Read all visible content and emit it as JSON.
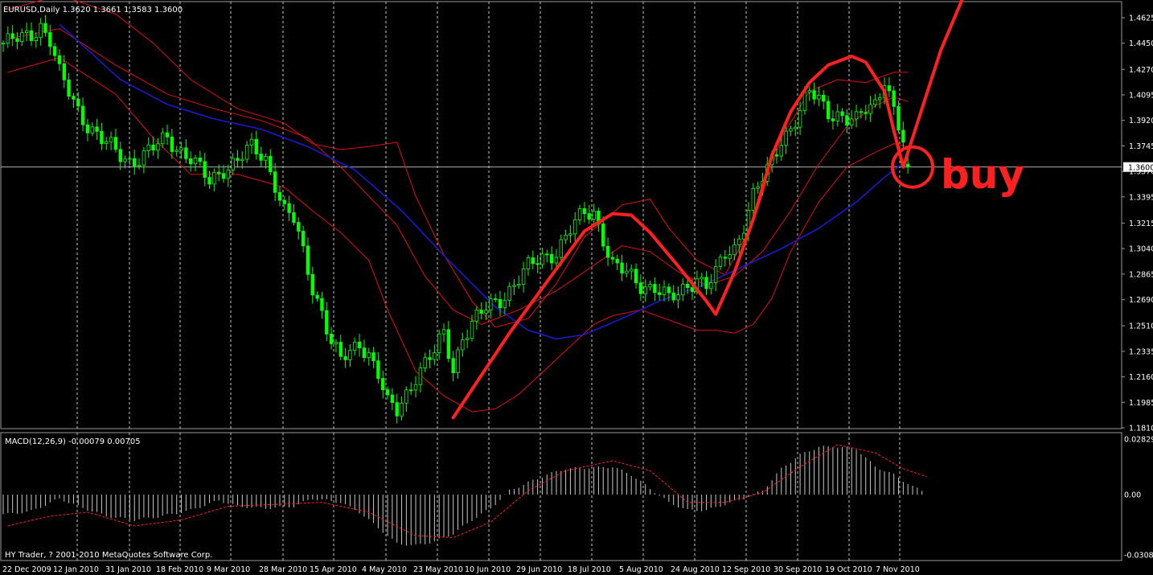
{
  "main_label": "EURUSD,Daily  1.3620 1.3661 1.3583 1.3600",
  "macd_label": "MACD(12,26,9) -0.00079 0.00705",
  "copyright": "HY Trader, ? 2001-2010 MetaQuotes Software Corp.",
  "buy_label": "buy",
  "colors": {
    "background": "#000000",
    "candle": "#00ff00",
    "ma": "#1a1ad0",
    "bands": "#e01010",
    "annotation": "#ff2020",
    "grid": "#c8c8c8",
    "axis_text": "#ffffff",
    "macd_hist": "#c8c8c8",
    "macd_signal": "#ff2020"
  },
  "chart_data": [
    {
      "type": "candlestick",
      "title": "EURUSD,Daily",
      "ohlc_last": {
        "open": 1.362,
        "high": 1.3661,
        "low": 1.3583,
        "close": 1.36
      },
      "ylim": [
        1.181,
        1.471
      ],
      "y_ticks": [
        "1.4625",
        "1.4450",
        "1.4270",
        "1.4095",
        "1.3920",
        "1.3745",
        "1.3570",
        "1.3395",
        "1.3215",
        "1.3040",
        "1.2865",
        "1.2690",
        "1.2510",
        "1.2335",
        "1.2160",
        "1.1985",
        "1.1810"
      ],
      "current_price_label": "1.3600",
      "x_ticks": [
        "22 Dec 2009",
        "12 Jan 2010",
        "31 Jan 2010",
        "18 Feb 2010",
        "9 Mar 2010",
        "28 Mar 2010",
        "15 Apr 2010",
        "4 May 2010",
        "23 May 2010",
        "10 Jun 2010",
        "29 Jun 2010",
        "18 Jul 2010",
        "5 Aug 2010",
        "24 Aug 2010",
        "12 Sep 2010",
        "30 Sep 2010",
        "19 Oct 2010",
        "7 Nov 2010"
      ],
      "close_path": [
        [
          1,
          1.445
        ],
        [
          4,
          1.448
        ],
        [
          6,
          1.452
        ],
        [
          8,
          1.458
        ],
        [
          10,
          1.447
        ],
        [
          12,
          1.423
        ],
        [
          15,
          1.405
        ],
        [
          18,
          1.39
        ],
        [
          21,
          1.378
        ],
        [
          24,
          1.37
        ],
        [
          27,
          1.365
        ],
        [
          30,
          1.368
        ],
        [
          32,
          1.372
        ],
        [
          35,
          1.38
        ],
        [
          38,
          1.372
        ],
        [
          40,
          1.366
        ],
        [
          42,
          1.357
        ],
        [
          44,
          1.349
        ],
        [
          47,
          1.36
        ],
        [
          50,
          1.365
        ],
        [
          53,
          1.372
        ],
        [
          56,
          1.366
        ],
        [
          58,
          1.35
        ],
        [
          60,
          1.33
        ],
        [
          62,
          1.323
        ],
        [
          64,
          1.3
        ],
        [
          66,
          1.278
        ],
        [
          68,
          1.262
        ],
        [
          70,
          1.24
        ],
        [
          72,
          1.226
        ],
        [
          74,
          1.232
        ],
        [
          76,
          1.24
        ],
        [
          78,
          1.233
        ],
        [
          80,
          1.218
        ],
        [
          82,
          1.196
        ],
        [
          84,
          1.192
        ],
        [
          86,
          1.205
        ],
        [
          88,
          1.218
        ],
        [
          90,
          1.225
        ],
        [
          92,
          1.232
        ],
        [
          94,
          1.245
        ],
        [
          96,
          1.222
        ],
        [
          98,
          1.245
        ],
        [
          100,
          1.252
        ],
        [
          103,
          1.262
        ],
        [
          106,
          1.27
        ],
        [
          109,
          1.28
        ],
        [
          112,
          1.29
        ],
        [
          115,
          1.298
        ],
        [
          118,
          1.303
        ],
        [
          121,
          1.316
        ],
        [
          124,
          1.328
        ],
        [
          126,
          1.33
        ],
        [
          128,
          1.312
        ],
        [
          130,
          1.292
        ],
        [
          133,
          1.286
        ],
        [
          136,
          1.28
        ],
        [
          139,
          1.278
        ],
        [
          142,
          1.268
        ],
        [
          144,
          1.272
        ],
        [
          146,
          1.28
        ],
        [
          148,
          1.285
        ],
        [
          150,
          1.278
        ],
        [
          152,
          1.285
        ],
        [
          154,
          1.3
        ],
        [
          156,
          1.305
        ],
        [
          158,
          1.322
        ],
        [
          160,
          1.34
        ],
        [
          163,
          1.356
        ],
        [
          166,
          1.38
        ],
        [
          168,
          1.388
        ],
        [
          170,
          1.398
        ],
        [
          172,
          1.41
        ],
        [
          174,
          1.406
        ],
        [
          176,
          1.399
        ],
        [
          178,
          1.397
        ],
        [
          180,
          1.392
        ],
        [
          182,
          1.39
        ],
        [
          184,
          1.4
        ],
        [
          186,
          1.405
        ],
        [
          188,
          1.422
        ],
        [
          190,
          1.398
        ],
        [
          192,
          1.375
        ],
        [
          193,
          1.36
        ]
      ],
      "ma_path": [
        [
          12,
          1.458
        ],
        [
          25,
          1.42
        ],
        [
          35,
          1.403
        ],
        [
          45,
          1.393
        ],
        [
          55,
          1.386
        ],
        [
          65,
          1.374
        ],
        [
          75,
          1.358
        ],
        [
          85,
          1.33
        ],
        [
          95,
          1.296
        ],
        [
          105,
          1.264
        ],
        [
          112,
          1.248
        ],
        [
          118,
          1.242
        ],
        [
          124,
          1.245
        ],
        [
          132,
          1.256
        ],
        [
          140,
          1.268
        ],
        [
          150,
          1.28
        ],
        [
          158,
          1.292
        ],
        [
          166,
          1.304
        ],
        [
          174,
          1.318
        ],
        [
          182,
          1.336
        ],
        [
          188,
          1.353
        ],
        [
          193,
          1.365
        ]
      ],
      "band_upper_path": [
        [
          1,
          1.468
        ],
        [
          12,
          1.478
        ],
        [
          24,
          1.465
        ],
        [
          32,
          1.445
        ],
        [
          40,
          1.42
        ],
        [
          50,
          1.4
        ],
        [
          60,
          1.39
        ],
        [
          66,
          1.376
        ],
        [
          72,
          1.372
        ],
        [
          78,
          1.374
        ],
        [
          84,
          1.377
        ],
        [
          88,
          1.34
        ],
        [
          94,
          1.3
        ],
        [
          100,
          1.268
        ],
        [
          105,
          1.25
        ],
        [
          112,
          1.256
        ],
        [
          118,
          1.28
        ],
        [
          124,
          1.312
        ],
        [
          132,
          1.334
        ],
        [
          138,
          1.338
        ],
        [
          142,
          1.318
        ],
        [
          148,
          1.296
        ],
        [
          154,
          1.286
        ],
        [
          160,
          1.322
        ],
        [
          166,
          1.38
        ],
        [
          172,
          1.412
        ],
        [
          178,
          1.42
        ],
        [
          184,
          1.418
        ],
        [
          190,
          1.425
        ],
        [
          193,
          1.425
        ]
      ],
      "band_middle_path": [
        [
          1,
          1.448
        ],
        [
          12,
          1.455
        ],
        [
          24,
          1.43
        ],
        [
          35,
          1.41
        ],
        [
          45,
          1.4
        ],
        [
          55,
          1.392
        ],
        [
          65,
          1.38
        ],
        [
          72,
          1.36
        ],
        [
          78,
          1.34
        ],
        [
          84,
          1.32
        ],
        [
          90,
          1.285
        ],
        [
          96,
          1.262
        ],
        [
          102,
          1.252
        ],
        [
          110,
          1.262
        ],
        [
          118,
          1.275
        ],
        [
          124,
          1.288
        ],
        [
          132,
          1.306
        ],
        [
          138,
          1.302
        ],
        [
          144,
          1.288
        ],
        [
          150,
          1.279
        ],
        [
          156,
          1.285
        ],
        [
          162,
          1.302
        ],
        [
          168,
          1.33
        ],
        [
          174,
          1.362
        ],
        [
          180,
          1.388
        ],
        [
          186,
          1.402
        ],
        [
          190,
          1.408
        ],
        [
          193,
          1.405
        ]
      ],
      "band_lower_path": [
        [
          1,
          1.425
        ],
        [
          12,
          1.435
        ],
        [
          24,
          1.41
        ],
        [
          32,
          1.38
        ],
        [
          40,
          1.355
        ],
        [
          50,
          1.355
        ],
        [
          60,
          1.346
        ],
        [
          66,
          1.33
        ],
        [
          72,
          1.315
        ],
        [
          78,
          1.296
        ],
        [
          82,
          1.262
        ],
        [
          88,
          1.22
        ],
        [
          94,
          1.203
        ],
        [
          100,
          1.192
        ],
        [
          105,
          1.194
        ],
        [
          110,
          1.204
        ],
        [
          116,
          1.222
        ],
        [
          122,
          1.24
        ],
        [
          126,
          1.252
        ],
        [
          130,
          1.258
        ],
        [
          136,
          1.262
        ],
        [
          142,
          1.255
        ],
        [
          148,
          1.248
        ],
        [
          152,
          1.248
        ],
        [
          156,
          1.246
        ],
        [
          160,
          1.252
        ],
        [
          164,
          1.27
        ],
        [
          168,
          1.302
        ],
        [
          174,
          1.336
        ],
        [
          180,
          1.36
        ],
        [
          186,
          1.37
        ],
        [
          190,
          1.376
        ],
        [
          193,
          1.374
        ]
      ],
      "annotation_path": [
        [
          96,
          1.188
        ],
        [
          108,
          1.246
        ],
        [
          118,
          1.29
        ],
        [
          124,
          1.316
        ],
        [
          130,
          1.328
        ],
        [
          134,
          1.327
        ],
        [
          138,
          1.315
        ],
        [
          144,
          1.292
        ],
        [
          150,
          1.268
        ],
        [
          152,
          1.259
        ],
        [
          156,
          1.288
        ],
        [
          160,
          1.324
        ],
        [
          164,
          1.368
        ],
        [
          168,
          1.398
        ],
        [
          172,
          1.418
        ],
        [
          176,
          1.43
        ],
        [
          181,
          1.436
        ],
        [
          184,
          1.432
        ],
        [
          188,
          1.412
        ],
        [
          190,
          1.385
        ],
        [
          192,
          1.36
        ],
        [
          195,
          1.39
        ],
        [
          200,
          1.44
        ],
        [
          206,
          1.486
        ],
        [
          210,
          1.497
        ],
        [
          215,
          1.478
        ]
      ],
      "buy_circle_center": [
        194,
        1.36
      ],
      "x_range": [
        0,
        240
      ]
    },
    {
      "type": "bar",
      "title": "MACD(12,26,9)",
      "macd": -0.00079,
      "signal": 0.00705,
      "ylim": [
        -0.03082,
        0.02829
      ],
      "y_ticks": [
        "0.02829",
        "0.00",
        "-0.03082"
      ],
      "hist_path": [
        [
          1,
          -0.01
        ],
        [
          6,
          -0.0085
        ],
        [
          12,
          -0.002
        ],
        [
          16,
          -0.006
        ],
        [
          22,
          -0.011
        ],
        [
          28,
          -0.013
        ],
        [
          34,
          -0.011
        ],
        [
          40,
          -0.008
        ],
        [
          46,
          -0.003
        ],
        [
          50,
          -0.006
        ],
        [
          56,
          -0.007
        ],
        [
          62,
          -0.006
        ],
        [
          66,
          -0.002
        ],
        [
          72,
          -0.004
        ],
        [
          76,
          -0.009
        ],
        [
          80,
          -0.017
        ],
        [
          84,
          -0.025
        ],
        [
          88,
          -0.026
        ],
        [
          92,
          -0.024
        ],
        [
          96,
          -0.02
        ],
        [
          100,
          -0.013
        ],
        [
          104,
          -0.007
        ],
        [
          108,
          0.002
        ],
        [
          112,
          0.006
        ],
        [
          116,
          0.01
        ],
        [
          120,
          0.013
        ],
        [
          126,
          0.0135
        ],
        [
          130,
          0.014
        ],
        [
          134,
          0.01
        ],
        [
          138,
          0.003
        ],
        [
          142,
          -0.004
        ],
        [
          146,
          -0.008
        ],
        [
          150,
          -0.008
        ],
        [
          154,
          -0.005
        ],
        [
          158,
          -0.002
        ],
        [
          162,
          0.002
        ],
        [
          166,
          0.013
        ],
        [
          170,
          0.02
        ],
        [
          174,
          0.024
        ],
        [
          178,
          0.024
        ],
        [
          182,
          0.023
        ],
        [
          186,
          0.014
        ],
        [
          190,
          0.01
        ],
        [
          194,
          0.004
        ],
        [
          196,
          0.002
        ]
      ],
      "signal_path": [
        [
          1,
          -0.016
        ],
        [
          10,
          -0.011
        ],
        [
          18,
          -0.009
        ],
        [
          28,
          -0.016
        ],
        [
          38,
          -0.013
        ],
        [
          48,
          -0.006
        ],
        [
          58,
          -0.005
        ],
        [
          68,
          -0.004
        ],
        [
          78,
          -0.009
        ],
        [
          88,
          -0.021
        ],
        [
          96,
          -0.022
        ],
        [
          104,
          -0.014
        ],
        [
          112,
          0.002
        ],
        [
          120,
          0.012
        ],
        [
          130,
          0.017
        ],
        [
          138,
          0.012
        ],
        [
          146,
          -0.004
        ],
        [
          154,
          -0.004
        ],
        [
          162,
          0.001
        ],
        [
          170,
          0.014
        ],
        [
          178,
          0.025
        ],
        [
          186,
          0.021
        ],
        [
          192,
          0.013
        ],
        [
          197,
          0.009
        ]
      ]
    }
  ]
}
